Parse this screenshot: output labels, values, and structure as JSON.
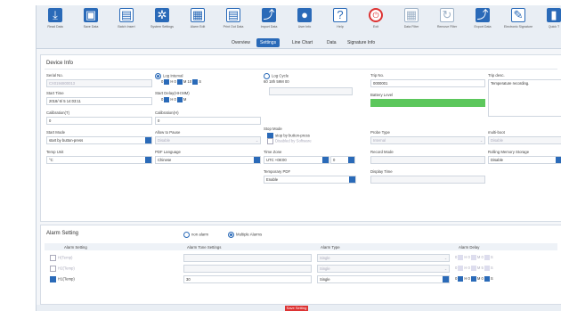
{
  "toolbar": [
    {
      "label": "Read Data",
      "icon": "download-icon",
      "glyph": "⤓",
      "style": ""
    },
    {
      "label": "Save Data",
      "icon": "save-icon",
      "glyph": "▣",
      "style": ""
    },
    {
      "label": "Batch Insert",
      "icon": "batch-icon",
      "glyph": "▤",
      "style": "o"
    },
    {
      "label": "System Settings",
      "icon": "gear-icon",
      "glyph": "✲",
      "style": ""
    },
    {
      "label": "Alarm Edit",
      "icon": "alarm-edit-icon",
      "glyph": "▦",
      "style": "o"
    },
    {
      "label": "Print Out Data",
      "icon": "print-icon",
      "glyph": "▤",
      "style": "o"
    },
    {
      "label": "Import Data",
      "icon": "import-icon",
      "glyph": "⤴",
      "style": ""
    },
    {
      "label": "User Info",
      "icon": "user-icon",
      "glyph": "●",
      "style": ""
    },
    {
      "label": "Help",
      "icon": "help-icon",
      "glyph": "?",
      "style": "o"
    },
    {
      "label": "Exit",
      "icon": "power-icon",
      "glyph": "⏻",
      "style": "r"
    },
    {
      "label": "Data Filter",
      "icon": "filter-icon",
      "glyph": "▦",
      "style": "g"
    },
    {
      "label": "Remove Filter",
      "icon": "refresh-icon",
      "glyph": "↻",
      "style": "g"
    },
    {
      "label": "Export Data",
      "icon": "export-icon",
      "glyph": "⤴",
      "style": ""
    },
    {
      "label": "Electronic Signature",
      "icon": "signature-icon",
      "glyph": "✎",
      "style": "o"
    },
    {
      "label": "Quick T",
      "icon": "quick-icon",
      "glyph": "▮",
      "style": ""
    }
  ],
  "tabs": [
    {
      "label": "Overview",
      "active": false
    },
    {
      "label": "Settings",
      "active": true
    },
    {
      "label": "Line Chart",
      "active": false
    },
    {
      "label": "Data",
      "active": false
    },
    {
      "label": "Signature Info",
      "active": false
    }
  ],
  "device": {
    "title": "Device Info",
    "serial_label": "Serial No.",
    "serial_value": "CX0194800013",
    "log_interval_label": "Log Interval",
    "log_interval": {
      "h": "0",
      "m": "0",
      "s": "10"
    },
    "log_cycle_label": "Log Cycle",
    "log_cycle_value": "60 18h 59M 00",
    "trip_label": "Trip No.",
    "trip_value": "0000001",
    "trip_desc_label": "Trip desc.",
    "trip_desc_value": "Temperature recording.",
    "start_time_label": "Start Time",
    "start_time_value": "2018/ 6/ 5 14:03:11",
    "start_delay_label": "Start Delay(HH:MM)",
    "start_delay": {
      "h": "0",
      "m": "0"
    },
    "battery_label": "Battery Level",
    "calib_t_label": "Calibration(T)",
    "calib_t_value": "0",
    "calib_h_label": "Calibration(H)",
    "calib_h_value": "0",
    "stop_mode_label": "Stop Mode",
    "stop_opt1": "stop by button-press",
    "stop_opt2": "Disabled by Software",
    "probe_label": "Probe Type",
    "probe_value": "Internal",
    "multi_label": "multi-boot",
    "multi_value": "Disable",
    "start_mode_label": "Start Mode",
    "start_mode_value": "start by button-press",
    "allow_pause_label": "Allow to Pause",
    "allow_pause_value": "Disable",
    "tz_label": "Time Zone",
    "tz_value": "UTC +08:00",
    "tz_min": "0",
    "record_mode_label": "Record Mode",
    "rolling_label": "Rolling Memory Storage",
    "rolling_value": "Disable",
    "temp_unit_label": "Temp Unit",
    "temp_unit_value": "°C",
    "pdf_lang_label": "PDF Language",
    "pdf_lang_value": "Chinese",
    "temp_pdf_label": "Temporary PDF",
    "temp_pdf_value": "Enable",
    "display_time_label": "Display Time"
  },
  "alarm": {
    "title": "Alarm Setting",
    "no_alarm": "non alarm",
    "multiple": "Multiple Alarms",
    "headers": [
      "Alarm Setting",
      "Alarm Tone Settings",
      "Alarm Type",
      "Alarm Delay"
    ],
    "rows": [
      {
        "label": "H(Temp)",
        "tone": "",
        "type": "Single",
        "checked": false,
        "delay": {
          "h": "0",
          "m": "0",
          "s": "0"
        }
      },
      {
        "label": "H2(Temp)",
        "tone": "",
        "type": "Single",
        "checked": false,
        "delay": {
          "h": "0",
          "m": "0",
          "s": "5"
        }
      },
      {
        "label": "H1(Temp)",
        "tone": "30",
        "type": "Single",
        "checked": true,
        "delay": {
          "h": "0",
          "m": "0",
          "s": "0"
        }
      }
    ]
  },
  "footer": {
    "button": "Save Setting"
  }
}
